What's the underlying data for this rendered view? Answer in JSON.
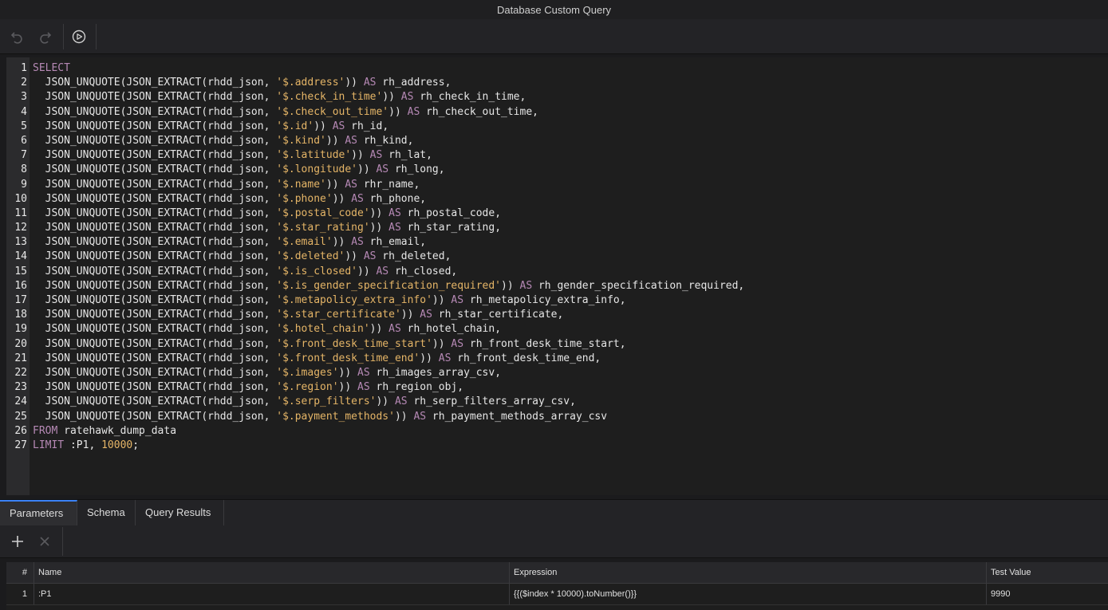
{
  "window": {
    "title": "Database Custom Query"
  },
  "toolbar": {
    "undo_icon": "undo-icon",
    "redo_icon": "redo-icon",
    "run_icon": "play-circle-icon"
  },
  "editor": {
    "lines": [
      [
        [
          "kw",
          "SELECT"
        ]
      ],
      [
        [
          "t",
          "  JSON_UNQUOTE(JSON_EXTRACT(rhdd_json, "
        ],
        [
          "str",
          "'$.address'"
        ],
        [
          "t",
          ")) "
        ],
        [
          "kw",
          "AS"
        ],
        [
          "t",
          " rh_address,"
        ]
      ],
      [
        [
          "t",
          "  JSON_UNQUOTE(JSON_EXTRACT(rhdd_json, "
        ],
        [
          "str",
          "'$.check_in_time'"
        ],
        [
          "t",
          ")) "
        ],
        [
          "kw",
          "AS"
        ],
        [
          "t",
          " rh_check_in_time,"
        ]
      ],
      [
        [
          "t",
          "  JSON_UNQUOTE(JSON_EXTRACT(rhdd_json, "
        ],
        [
          "str",
          "'$.check_out_time'"
        ],
        [
          "t",
          ")) "
        ],
        [
          "kw",
          "AS"
        ],
        [
          "t",
          " rh_check_out_time,"
        ]
      ],
      [
        [
          "t",
          "  JSON_UNQUOTE(JSON_EXTRACT(rhdd_json, "
        ],
        [
          "str",
          "'$.id'"
        ],
        [
          "t",
          ")) "
        ],
        [
          "kw",
          "AS"
        ],
        [
          "t",
          " rh_id,"
        ]
      ],
      [
        [
          "t",
          "  JSON_UNQUOTE(JSON_EXTRACT(rhdd_json, "
        ],
        [
          "str",
          "'$.kind'"
        ],
        [
          "t",
          ")) "
        ],
        [
          "kw",
          "AS"
        ],
        [
          "t",
          " rh_kind,"
        ]
      ],
      [
        [
          "t",
          "  JSON_UNQUOTE(JSON_EXTRACT(rhdd_json, "
        ],
        [
          "str",
          "'$.latitude'"
        ],
        [
          "t",
          ")) "
        ],
        [
          "kw",
          "AS"
        ],
        [
          "t",
          " rh_lat,"
        ]
      ],
      [
        [
          "t",
          "  JSON_UNQUOTE(JSON_EXTRACT(rhdd_json, "
        ],
        [
          "str",
          "'$.longitude'"
        ],
        [
          "t",
          ")) "
        ],
        [
          "kw",
          "AS"
        ],
        [
          "t",
          " rh_long,"
        ]
      ],
      [
        [
          "t",
          "  JSON_UNQUOTE(JSON_EXTRACT(rhdd_json, "
        ],
        [
          "str",
          "'$.name'"
        ],
        [
          "t",
          ")) "
        ],
        [
          "kw",
          "AS"
        ],
        [
          "t",
          " rhr_name,"
        ]
      ],
      [
        [
          "t",
          "  JSON_UNQUOTE(JSON_EXTRACT(rhdd_json, "
        ],
        [
          "str",
          "'$.phone'"
        ],
        [
          "t",
          ")) "
        ],
        [
          "kw",
          "AS"
        ],
        [
          "t",
          " rh_phone,"
        ]
      ],
      [
        [
          "t",
          "  JSON_UNQUOTE(JSON_EXTRACT(rhdd_json, "
        ],
        [
          "str",
          "'$.postal_code'"
        ],
        [
          "t",
          ")) "
        ],
        [
          "kw",
          "AS"
        ],
        [
          "t",
          " rh_postal_code,"
        ]
      ],
      [
        [
          "t",
          "  JSON_UNQUOTE(JSON_EXTRACT(rhdd_json, "
        ],
        [
          "str",
          "'$.star_rating'"
        ],
        [
          "t",
          ")) "
        ],
        [
          "kw",
          "AS"
        ],
        [
          "t",
          " rh_star_rating,"
        ]
      ],
      [
        [
          "t",
          "  JSON_UNQUOTE(JSON_EXTRACT(rhdd_json, "
        ],
        [
          "str",
          "'$.email'"
        ],
        [
          "t",
          ")) "
        ],
        [
          "kw",
          "AS"
        ],
        [
          "t",
          " rh_email,"
        ]
      ],
      [
        [
          "t",
          "  JSON_UNQUOTE(JSON_EXTRACT(rhdd_json, "
        ],
        [
          "str",
          "'$.deleted'"
        ],
        [
          "t",
          ")) "
        ],
        [
          "kw",
          "AS"
        ],
        [
          "t",
          " rh_deleted,"
        ]
      ],
      [
        [
          "t",
          "  JSON_UNQUOTE(JSON_EXTRACT(rhdd_json, "
        ],
        [
          "str",
          "'$.is_closed'"
        ],
        [
          "t",
          ")) "
        ],
        [
          "kw",
          "AS"
        ],
        [
          "t",
          " rh_closed,"
        ]
      ],
      [
        [
          "t",
          "  JSON_UNQUOTE(JSON_EXTRACT(rhdd_json, "
        ],
        [
          "str",
          "'$.is_gender_specification_required'"
        ],
        [
          "t",
          ")) "
        ],
        [
          "kw",
          "AS"
        ],
        [
          "t",
          " rh_gender_specification_required,"
        ]
      ],
      [
        [
          "t",
          "  JSON_UNQUOTE(JSON_EXTRACT(rhdd_json, "
        ],
        [
          "str",
          "'$.metapolicy_extra_info'"
        ],
        [
          "t",
          ")) "
        ],
        [
          "kw",
          "AS"
        ],
        [
          "t",
          " rh_metapolicy_extra_info,"
        ]
      ],
      [
        [
          "t",
          "  JSON_UNQUOTE(JSON_EXTRACT(rhdd_json, "
        ],
        [
          "str",
          "'$.star_certificate'"
        ],
        [
          "t",
          ")) "
        ],
        [
          "kw",
          "AS"
        ],
        [
          "t",
          " rh_star_certificate,"
        ]
      ],
      [
        [
          "t",
          "  JSON_UNQUOTE(JSON_EXTRACT(rhdd_json, "
        ],
        [
          "str",
          "'$.hotel_chain'"
        ],
        [
          "t",
          ")) "
        ],
        [
          "kw",
          "AS"
        ],
        [
          "t",
          " rh_hotel_chain,"
        ]
      ],
      [
        [
          "t",
          "  JSON_UNQUOTE(JSON_EXTRACT(rhdd_json, "
        ],
        [
          "str",
          "'$.front_desk_time_start'"
        ],
        [
          "t",
          ")) "
        ],
        [
          "kw",
          "AS"
        ],
        [
          "t",
          " rh_front_desk_time_start,"
        ]
      ],
      [
        [
          "t",
          "  JSON_UNQUOTE(JSON_EXTRACT(rhdd_json, "
        ],
        [
          "str",
          "'$.front_desk_time_end'"
        ],
        [
          "t",
          ")) "
        ],
        [
          "kw",
          "AS"
        ],
        [
          "t",
          " rh_front_desk_time_end,"
        ]
      ],
      [
        [
          "t",
          "  JSON_UNQUOTE(JSON_EXTRACT(rhdd_json, "
        ],
        [
          "str",
          "'$.images'"
        ],
        [
          "t",
          ")) "
        ],
        [
          "kw",
          "AS"
        ],
        [
          "t",
          " rh_images_array_csv,"
        ]
      ],
      [
        [
          "t",
          "  JSON_UNQUOTE(JSON_EXTRACT(rhdd_json, "
        ],
        [
          "str",
          "'$.region'"
        ],
        [
          "t",
          ")) "
        ],
        [
          "kw",
          "AS"
        ],
        [
          "t",
          " rh_region_obj,"
        ]
      ],
      [
        [
          "t",
          "  JSON_UNQUOTE(JSON_EXTRACT(rhdd_json, "
        ],
        [
          "str",
          "'$.serp_filters'"
        ],
        [
          "t",
          ")) "
        ],
        [
          "kw",
          "AS"
        ],
        [
          "t",
          " rh_serp_filters_array_csv,"
        ]
      ],
      [
        [
          "t",
          "  JSON_UNQUOTE(JSON_EXTRACT(rhdd_json, "
        ],
        [
          "str",
          "'$.payment_methods'"
        ],
        [
          "t",
          ")) "
        ],
        [
          "kw",
          "AS"
        ],
        [
          "t",
          " rh_payment_methods_array_csv"
        ]
      ],
      [
        [
          "kw",
          "FROM"
        ],
        [
          "t",
          " ratehawk_dump_data"
        ]
      ],
      [
        [
          "kw",
          "LIMIT"
        ],
        [
          "t",
          " :P1, "
        ],
        [
          "num",
          "10000"
        ],
        [
          "t",
          ";"
        ]
      ]
    ]
  },
  "tabs": [
    {
      "label": "Parameters",
      "active": true
    },
    {
      "label": "Schema",
      "active": false
    },
    {
      "label": "Query Results",
      "active": false
    }
  ],
  "params_toolbar": {
    "add_icon": "plus-icon",
    "remove_icon": "close-icon"
  },
  "params_table": {
    "headers": [
      "#",
      "Name",
      "Expression",
      "Test Value"
    ],
    "rows": [
      [
        "1",
        ":P1",
        "{{($index * 10000).toNumber()}}",
        "9990"
      ]
    ]
  },
  "colors": {
    "keyword": "#b689b5",
    "string": "#e5b567",
    "accent": "#3b82f6"
  }
}
